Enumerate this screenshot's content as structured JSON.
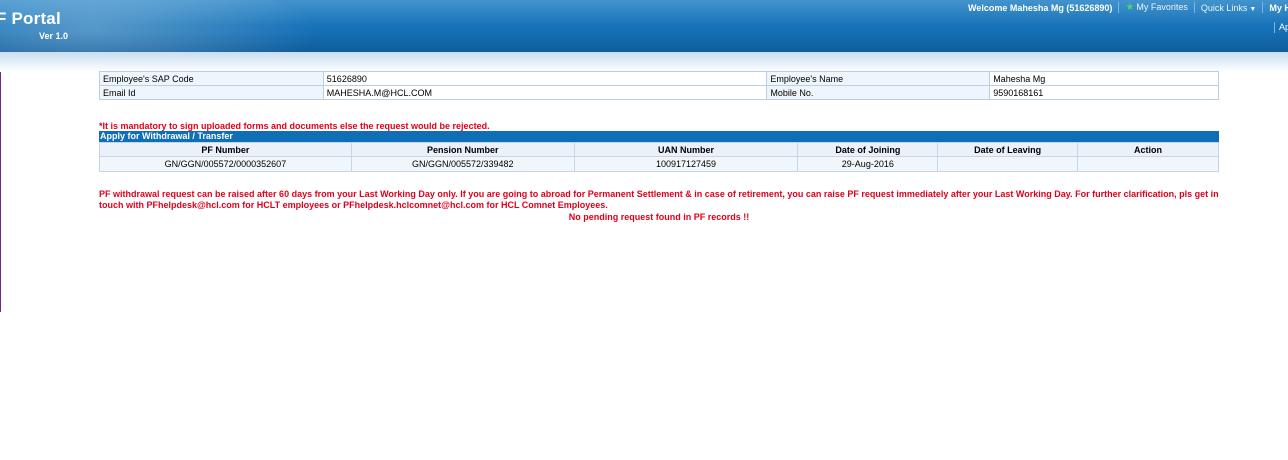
{
  "header": {
    "title": "F Portal",
    "version": "Ver 1.0",
    "welcome": "Welcome Mahesha Mg (51626890)",
    "favorites": "My Favorites",
    "quick_links": "Quick Links",
    "my_hcl": "My HC",
    "ap": "Ap"
  },
  "employee": {
    "sap_code_label": "Employee's SAP Code",
    "sap_code": "51626890",
    "name_label": "Employee's Name",
    "name": "Mahesha Mg",
    "email_label": "Email Id",
    "email": "MAHESHA.M@HCL.COM",
    "mobile_label": "Mobile No.",
    "mobile": "9590168161"
  },
  "mandatory_note": "*It is mandatory to sign uploaded forms and documents else the request would be rejected.",
  "section_title": "Apply for Withdrawal / Transfer",
  "pf_table": {
    "headers": [
      "PF Number",
      "Pension Number",
      "UAN Number",
      "Date of Joining",
      "Date of Leaving",
      "Action"
    ],
    "rows": [
      [
        "GN/GGN/005572/0000352607",
        "GN/GGN/005572/339482",
        "100917127459",
        "29-Aug-2016",
        "",
        ""
      ]
    ]
  },
  "withdrawal_note": "PF withdrawal request can be raised after 60 days from your Last Working Day only. If you are going to abroad for Permanent Settlement & in case of retirement, you can raise PF request immediately after your Last Working Day. For further clarification, pls get in touch with PFhelpdesk@hcl.com for HCLT employees or PFhelpdesk.hclcomnet@hcl.com for HCL Comnet Employees.",
  "no_pending": "No pending request found in PF records !!",
  "icons": {
    "favorites": "star-icon",
    "quick_links": "caret-down-icon"
  },
  "colors": {
    "header_blue": "#1670b5",
    "section_blue": "#0f6fb6",
    "alert_red": "#e0001b",
    "favorite_green": "#4ed36f"
  }
}
